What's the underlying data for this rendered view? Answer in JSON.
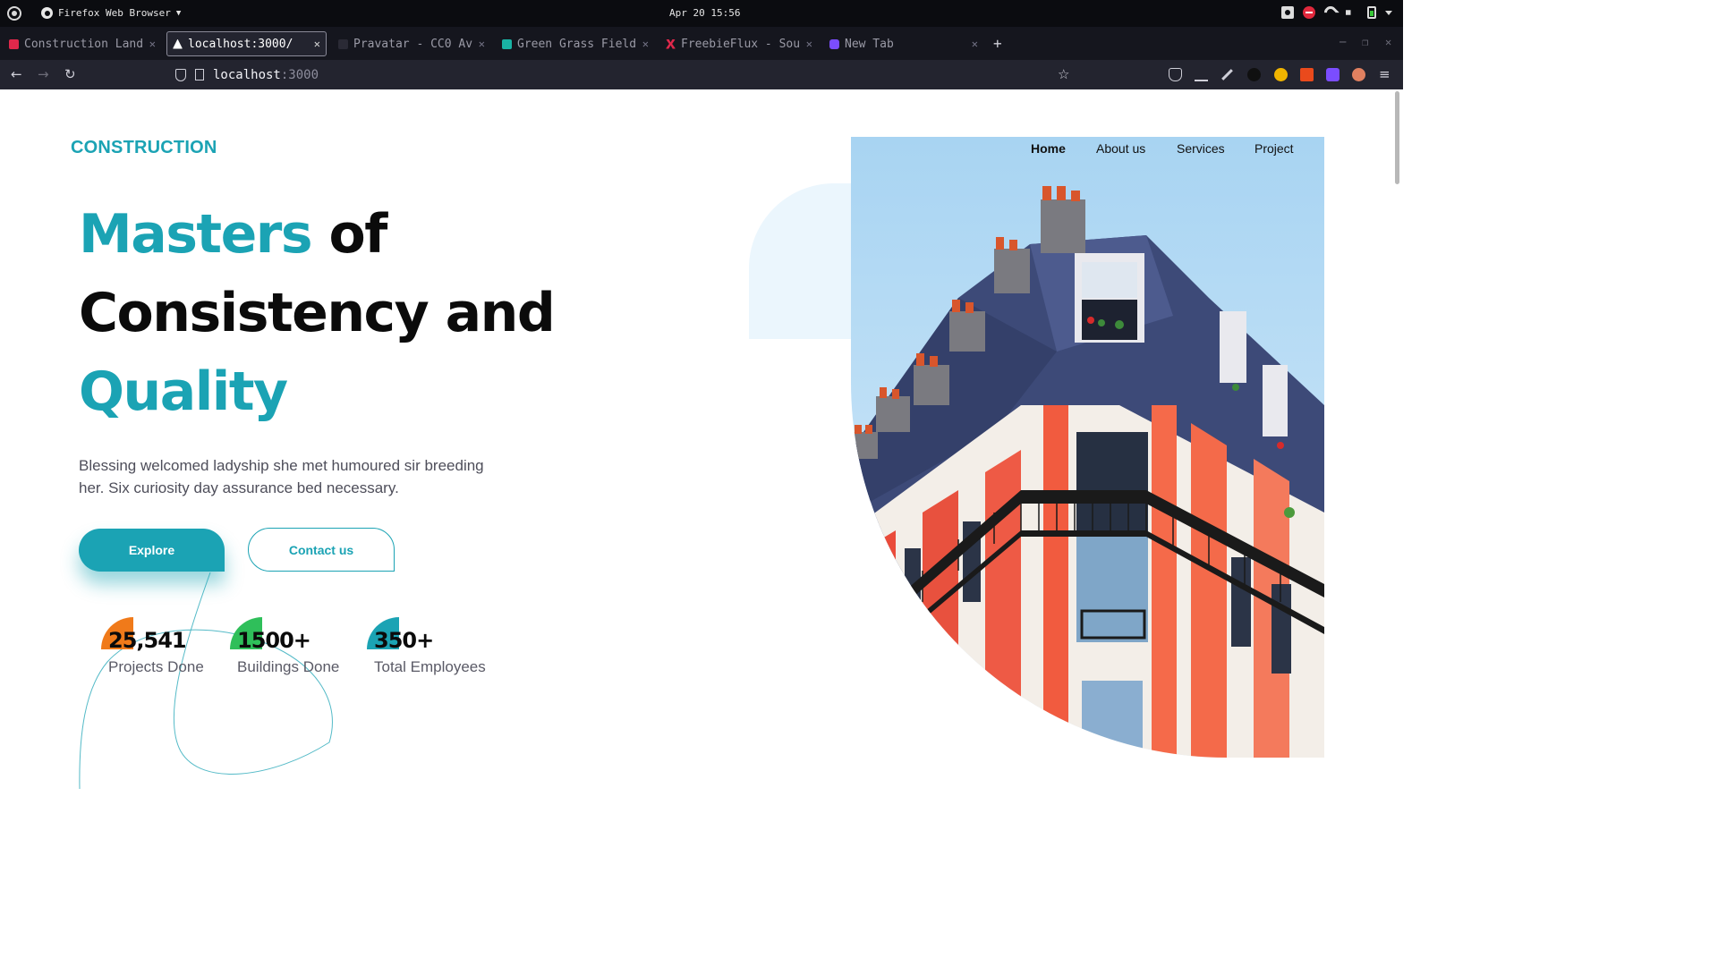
{
  "system_bar": {
    "app_name": "Firefox Web Browser",
    "clock": "Apr 20  15:56"
  },
  "browser": {
    "tabs": [
      {
        "title": "Construction Land",
        "favicon_color": "#e0284b",
        "active": false
      },
      {
        "title": "localhost:3000/",
        "favicon_color": "#ffffff",
        "active": true
      },
      {
        "title": "Pravatar - CC0 Av",
        "favicon_color": "#1a1a22",
        "active": false
      },
      {
        "title": "Green Grass Field",
        "favicon_color": "#19b3a4",
        "active": false
      },
      {
        "title": "FreebieFlux - Sou",
        "favicon_color": "#e0284b",
        "active": false
      },
      {
        "title": "New Tab",
        "favicon_color": "#7b4dff",
        "active": false
      }
    ],
    "url_host": "localhost",
    "url_port": ":3000"
  },
  "site": {
    "brand": "CONSTRUCTION",
    "nav": {
      "home": "Home",
      "about": "About us",
      "services": "Services",
      "project": "Project"
    },
    "hero": {
      "line1_accent": "Masters",
      "line1_rest": " of",
      "line2": "Consistency and",
      "line3_accent": "Quality",
      "lead": "Blessing welcomed ladyship she met humoured sir breeding her. Six curiosity day assurance bed necessary."
    },
    "buttons": {
      "explore": "Explore",
      "contact": "Contact us"
    },
    "stats": [
      {
        "value": "25,541",
        "label": "Projects Done",
        "accent": "#f07a1a"
      },
      {
        "value": "1500+",
        "label": "Buildings Done",
        "accent": "#2fbf5a"
      },
      {
        "value": "350+",
        "label": "Total Employees",
        "accent": "#1ba3b4"
      }
    ],
    "colors": {
      "accent": "#1ba3b4"
    }
  }
}
